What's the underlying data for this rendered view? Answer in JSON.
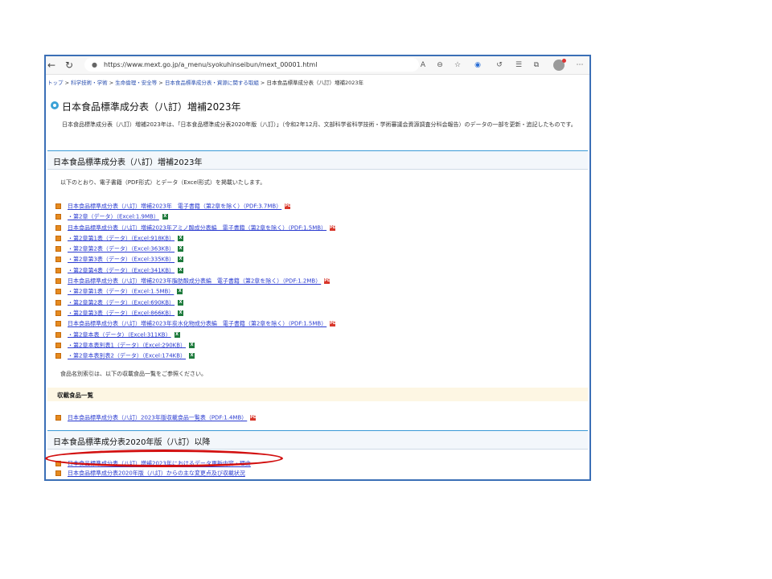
{
  "browser": {
    "url": "https://www.mext.go.jp/a_menu/syokuhinseibun/mext_00001.html",
    "back_icon": "←",
    "reload_icon": "↻",
    "lock_icon": "🔒"
  },
  "breadcrumb": {
    "items": [
      "トップ",
      "科学技術・学術",
      "生命倫理・安全等",
      "日本食品標準成分表・資源に関する取組",
      "日本食品標準成分表（八訂）増補2023年"
    ],
    "separator": ">"
  },
  "page": {
    "title": "日本食品標準成分表（八訂）増補2023年",
    "intro": "日本食品標準成分表（八訂）増補2023年は、「日本食品標準成分表2020年版（八訂）」（令和2年12月、文部科学省科学技術・学術審議会資源調査分科会報告）のデータの一部を更新・追記したものです。"
  },
  "section1": {
    "heading": "日本食品標準成分表（八訂）増補2023年",
    "note": "以下のとおり、電子書籍（PDF形式）とデータ（Excel形式）を掲載いたします。",
    "links": [
      {
        "text": "日本食品標準成分表（八訂）増補2023年　電子書籍（第2章を除く）（PDF:3.7MB）",
        "icon": "pdf"
      },
      {
        "text": "・第2章（データ）（Excel:1.9MB）",
        "icon": "xls"
      },
      {
        "text": "日本食品標準成分表（八訂）増補2023年アミノ酸成分表編　電子書籍（第2章を除く）（PDF:1.5MB）",
        "icon": "pdf"
      },
      {
        "text": "・第2章第1表（データ）（Excel:918KB）",
        "icon": "xls"
      },
      {
        "text": "・第2章第2表（データ）（Excel:363KB）",
        "icon": "xls"
      },
      {
        "text": "・第2章第3表（データ）（Excel:335KB）",
        "icon": "xls"
      },
      {
        "text": "・第2章第4表（データ）（Excel:341KB）",
        "icon": "xls"
      },
      {
        "text": "日本食品標準成分表（八訂）増補2023年脂肪酸成分表編　電子書籍（第2章を除く）（PDF:1.2MB）",
        "icon": "pdf"
      },
      {
        "text": "・第2章第1表（データ）（Excel:1.5MB）",
        "icon": "xls"
      },
      {
        "text": "・第2章第2表（データ）（Excel:690KB）",
        "icon": "xls"
      },
      {
        "text": "・第2章第3表（データ）（Excel:866KB）",
        "icon": "xls"
      },
      {
        "text": "日本食品標準成分表（八訂）増補2023年炭水化物成分表編　電子書籍（第2章を除く）（PDF:1.5MB）",
        "icon": "pdf"
      },
      {
        "text": "・第2章本表（データ）（Excel:311KB）",
        "icon": "xls"
      },
      {
        "text": "・第2章本表別表1（データ）（Excel:290KB）",
        "icon": "xls"
      },
      {
        "text": "・第2章本表別表2（データ）（Excel:174KB）",
        "icon": "xls"
      }
    ],
    "index_note": "食品名別索引は、以下の収載食品一覧をご参照ください。",
    "subheading": "収載食品一覧",
    "catalog_link": "日本食品標準成分表（八訂）2023年版収載食品一覧表（PDF:1.4MB）"
  },
  "section2": {
    "heading": "日本食品標準成分表2020年版（八訂）以降",
    "link1": "日本食品標準成分表（八訂）増補2023年におけるデータ更新内容・理由",
    "link2": "日本食品標準成分表2020年版（八訂）からの主な変更点及び収載状況"
  },
  "icons": {
    "pdf": "PDF",
    "xls": "X"
  },
  "colors": {
    "accent": "#3a9ad6",
    "link": "#2a3bd0",
    "annotation": "#d21010",
    "frame": "#3b6fb6"
  }
}
